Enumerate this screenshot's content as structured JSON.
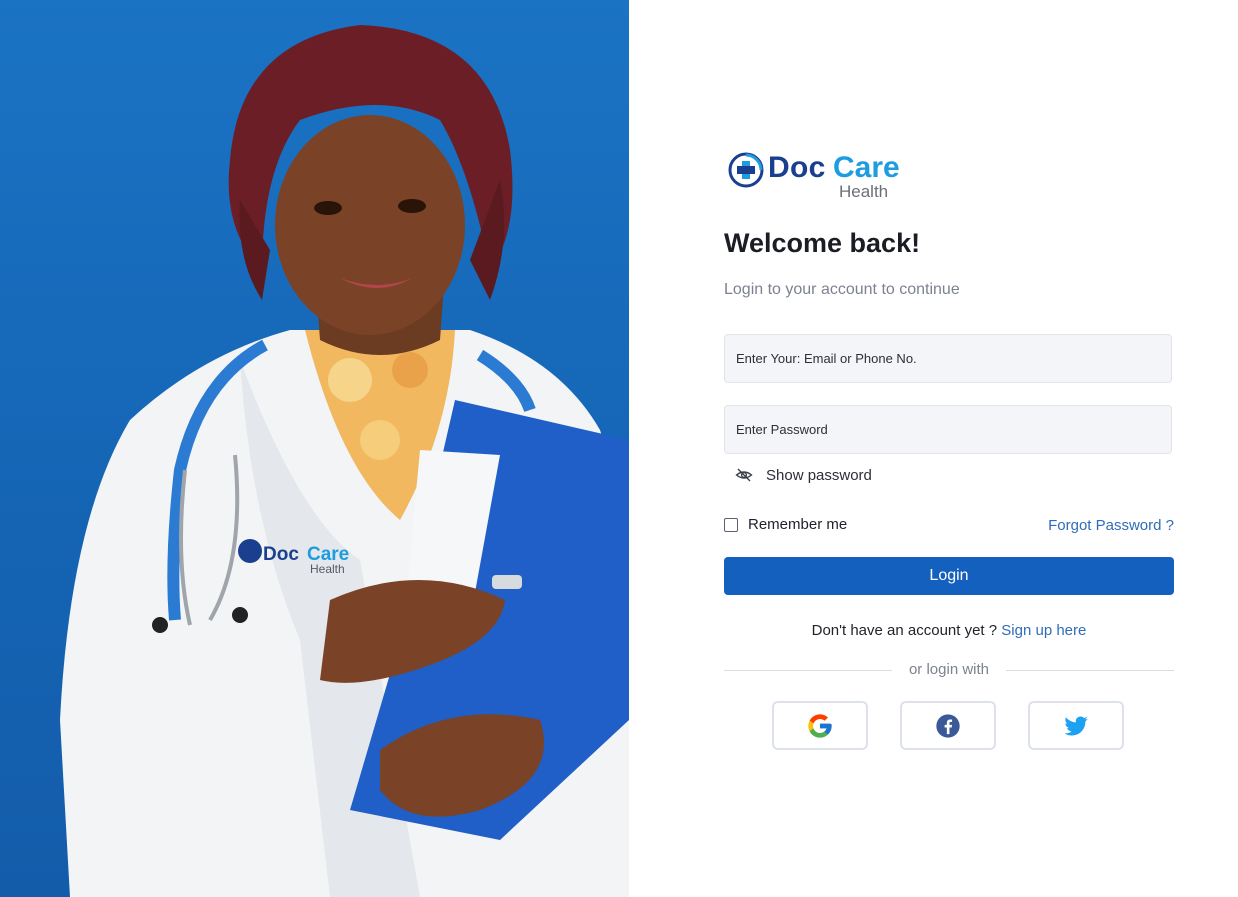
{
  "brand": {
    "name_part1": "Doc",
    "name_part2": "Care",
    "tagline": "Health"
  },
  "hero": {
    "image_alt_icon": "doctor-photo",
    "coat_logo_part1": "Doc",
    "coat_logo_part2": "Care",
    "coat_logo_tagline": "Health"
  },
  "login": {
    "title": "Welcome back!",
    "subtitle": "Login to your account to continue",
    "email_placeholder": "Enter Your: Email or Phone No.",
    "password_placeholder": "Enter Password",
    "show_password_label": "Show password",
    "remember_label": "Remember me",
    "forgot_label": "Forgot Password ?",
    "login_button": "Login",
    "signup_prompt": "Don't have an account yet ?",
    "signup_link": "Sign up here",
    "divider_text": "or login with"
  },
  "social": [
    {
      "name": "google",
      "icon": "google-icon"
    },
    {
      "name": "facebook",
      "icon": "facebook-icon"
    },
    {
      "name": "twitter",
      "icon": "twitter-icon"
    }
  ],
  "colors": {
    "primary": "#1460bf",
    "link": "#2f6db8",
    "brand_dark": "#1b3f8f",
    "brand_light": "#1d9ce0",
    "hero_bg": "#1565b5"
  }
}
